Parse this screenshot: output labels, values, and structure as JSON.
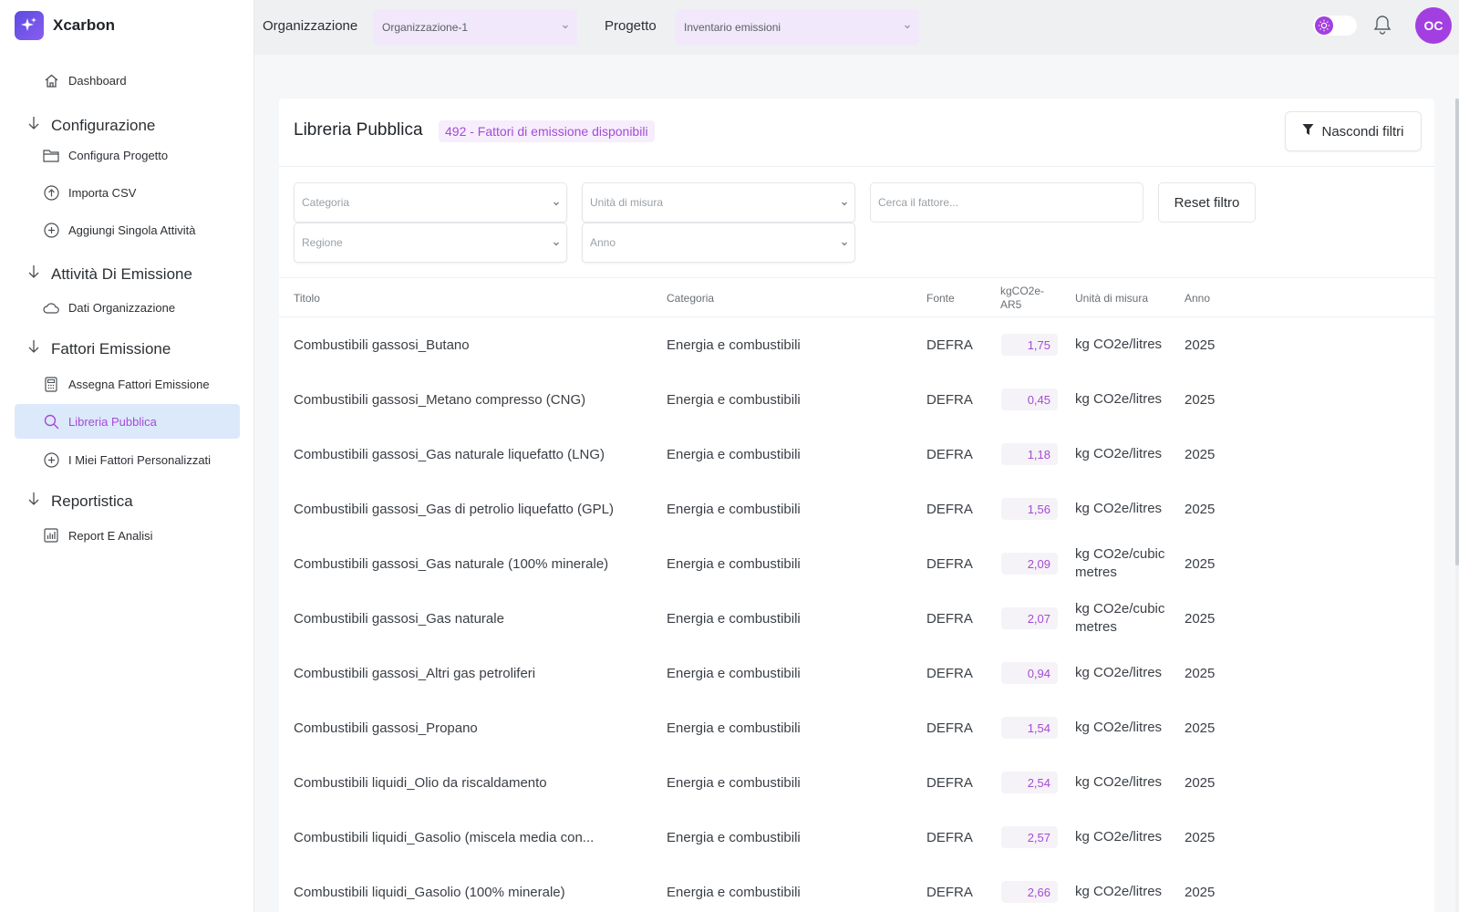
{
  "app": {
    "name": "Xcarbon"
  },
  "sidebar": {
    "dashboard": "Dashboard",
    "sections": [
      {
        "title": "Configurazione",
        "items": [
          "Configura Progetto",
          "Importa CSV",
          "Aggiungi Singola Attività"
        ]
      },
      {
        "title": "Attività Di Emissione",
        "items": [
          "Dati Organizzazione"
        ]
      },
      {
        "title": "Fattori Emissione",
        "items": [
          "Assegna Fattori Emissione",
          "Libreria Pubblica",
          "I Miei Fattori Personalizzati"
        ]
      },
      {
        "title": "Reportistica",
        "items": [
          "Report E Analisi"
        ]
      }
    ],
    "active_item": "Libreria Pubblica"
  },
  "topbar": {
    "org_label": "Organizzazione",
    "org_value": "Organizzazione-1",
    "project_label": "Progetto",
    "project_value": "Inventario emissioni",
    "avatar_initials": "OC"
  },
  "page": {
    "title": "Libreria Pubblica",
    "count_badge": "492 - Fattori di emissione disponibili",
    "hide_filters": "Nascondi filtri"
  },
  "filters": {
    "category_placeholder": "Categoria",
    "unit_placeholder": "Unità di misura",
    "search_placeholder": "Cerca il fattore...",
    "reset_label": "Reset filtro",
    "region_placeholder": "Regione",
    "year_placeholder": "Anno"
  },
  "table": {
    "headers": {
      "title": "Titolo",
      "category": "Categoria",
      "source": "Fonte",
      "value_line1": "kgCO2e-",
      "value_line2": "AR5",
      "unit": "Unità di misura",
      "year": "Anno"
    },
    "rows": [
      {
        "title": "Combustibili gassosi_Butano",
        "category": "Energia e combustibili",
        "source": "DEFRA",
        "value": "1,75",
        "unit": "kg CO2e/litres",
        "year": "2025"
      },
      {
        "title": "Combustibili gassosi_Metano compresso (CNG)",
        "category": "Energia e combustibili",
        "source": "DEFRA",
        "value": "0,45",
        "unit": "kg CO2e/litres",
        "year": "2025"
      },
      {
        "title": "Combustibili gassosi_Gas naturale liquefatto (LNG)",
        "category": "Energia e combustibili",
        "source": "DEFRA",
        "value": "1,18",
        "unit": "kg CO2e/litres",
        "year": "2025"
      },
      {
        "title": "Combustibili gassosi_Gas di petrolio liquefatto (GPL)",
        "category": "Energia e combustibili",
        "source": "DEFRA",
        "value": "1,56",
        "unit": "kg CO2e/litres",
        "year": "2025"
      },
      {
        "title": "Combustibili gassosi_Gas naturale (100% minerale)",
        "category": "Energia e combustibili",
        "source": "DEFRA",
        "value": "2,09",
        "unit": "kg CO2e/cubic metres",
        "year": "2025"
      },
      {
        "title": "Combustibili gassosi_Gas naturale",
        "category": "Energia e combustibili",
        "source": "DEFRA",
        "value": "2,07",
        "unit": "kg CO2e/cubic metres",
        "year": "2025"
      },
      {
        "title": "Combustibili gassosi_Altri gas petroliferi",
        "category": "Energia e combustibili",
        "source": "DEFRA",
        "value": "0,94",
        "unit": "kg CO2e/litres",
        "year": "2025"
      },
      {
        "title": "Combustibili gassosi_Propano",
        "category": "Energia e combustibili",
        "source": "DEFRA",
        "value": "1,54",
        "unit": "kg CO2e/litres",
        "year": "2025"
      },
      {
        "title": "Combustibili liquidi_Olio da riscaldamento",
        "category": "Energia e combustibili",
        "source": "DEFRA",
        "value": "2,54",
        "unit": "kg CO2e/litres",
        "year": "2025"
      },
      {
        "title": "Combustibili liquidi_Gasolio (miscela media con...",
        "category": "Energia e combustibili",
        "source": "DEFRA",
        "value": "2,57",
        "unit": "kg CO2e/litres",
        "year": "2025"
      },
      {
        "title": "Combustibili liquidi_Gasolio (100% minerale)",
        "category": "Energia e combustibili",
        "source": "DEFRA",
        "value": "2,66",
        "unit": "kg CO2e/litres",
        "year": "2025"
      }
    ]
  },
  "colors": {
    "accent": "#a64bd6",
    "brand": "#5b4ce0",
    "active_bg": "#dbe9fb",
    "select_bg": "#f1e8fb"
  },
  "icons": {
    "logo": "sparkle-icon",
    "dashboard": "home-icon",
    "section": "arrow-down-icon",
    "configure": "folder-icon",
    "import": "upload-circle-icon",
    "add": "plus-circle-icon",
    "org_data": "cloud-icon",
    "assign": "calculator-icon",
    "library": "search-icon",
    "custom": "plus-circle-icon",
    "report": "bar-chart-icon",
    "theme": "sun-icon",
    "notifications": "bell-icon",
    "filter": "filter-icon"
  }
}
